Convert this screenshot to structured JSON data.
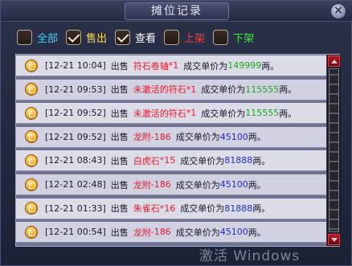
{
  "window": {
    "title": "摊位记录",
    "close_label": "×"
  },
  "filters": [
    {
      "label": "全部",
      "checked": false,
      "color": "#3fd2ff"
    },
    {
      "label": "售出",
      "checked": true,
      "color": "#ffd84a"
    },
    {
      "label": "查看",
      "checked": true,
      "color": "#ffffff"
    },
    {
      "label": "上架",
      "checked": false,
      "color": "#ff3b3b"
    },
    {
      "label": "下架",
      "checked": false,
      "color": "#46e04a"
    }
  ],
  "records": [
    {
      "time": "[12-21 10:04]",
      "action": "出售",
      "item": "符石卷轴",
      "qty": "*1",
      "price_label": "成交单价为",
      "price": "149999",
      "price_color": "#1ea81e",
      "unit": "两。"
    },
    {
      "time": "[12-21 09:53]",
      "action": "出售",
      "item": "未激活的符石",
      "qty": "*1",
      "price_label": "成交单价为",
      "price": "115555",
      "price_color": "#1ea81e",
      "unit": "两。"
    },
    {
      "time": "[12-21 09:52]",
      "action": "出售",
      "item": "未激活的符石",
      "qty": "*1",
      "price_label": "成交单价为",
      "price": "115555",
      "price_color": "#1ea81e",
      "unit": "两。"
    },
    {
      "time": "[12-21 09:52]",
      "action": "出售",
      "item": "龙附",
      "qty": "-186",
      "price_label": "成交单价为",
      "price": "45100",
      "price_color": "#2030d0",
      "unit": "两。"
    },
    {
      "time": "[12-21 08:43]",
      "action": "出售",
      "item": "白虎石",
      "qty": "*15",
      "price_label": "成交单价为",
      "price": "81888",
      "price_color": "#2030d0",
      "unit": "两。"
    },
    {
      "time": "[12-21 02:48]",
      "action": "出售",
      "item": "龙附",
      "qty": "-186",
      "price_label": "成交单价为",
      "price": "45100",
      "price_color": "#2030d0",
      "unit": "两。"
    },
    {
      "time": "[12-21 01:33]",
      "action": "出售",
      "item": "朱雀石",
      "qty": "*16",
      "price_label": "成交单价为",
      "price": "81888",
      "price_color": "#2030d0",
      "unit": "两。"
    },
    {
      "time": "[12-21 00:54]",
      "action": "出售",
      "item": "龙附",
      "qty": "-186",
      "price_label": "成交单价为",
      "price": "45100",
      "price_color": "#2030d0",
      "unit": "两。"
    }
  ],
  "watermark": "激活 Windows"
}
